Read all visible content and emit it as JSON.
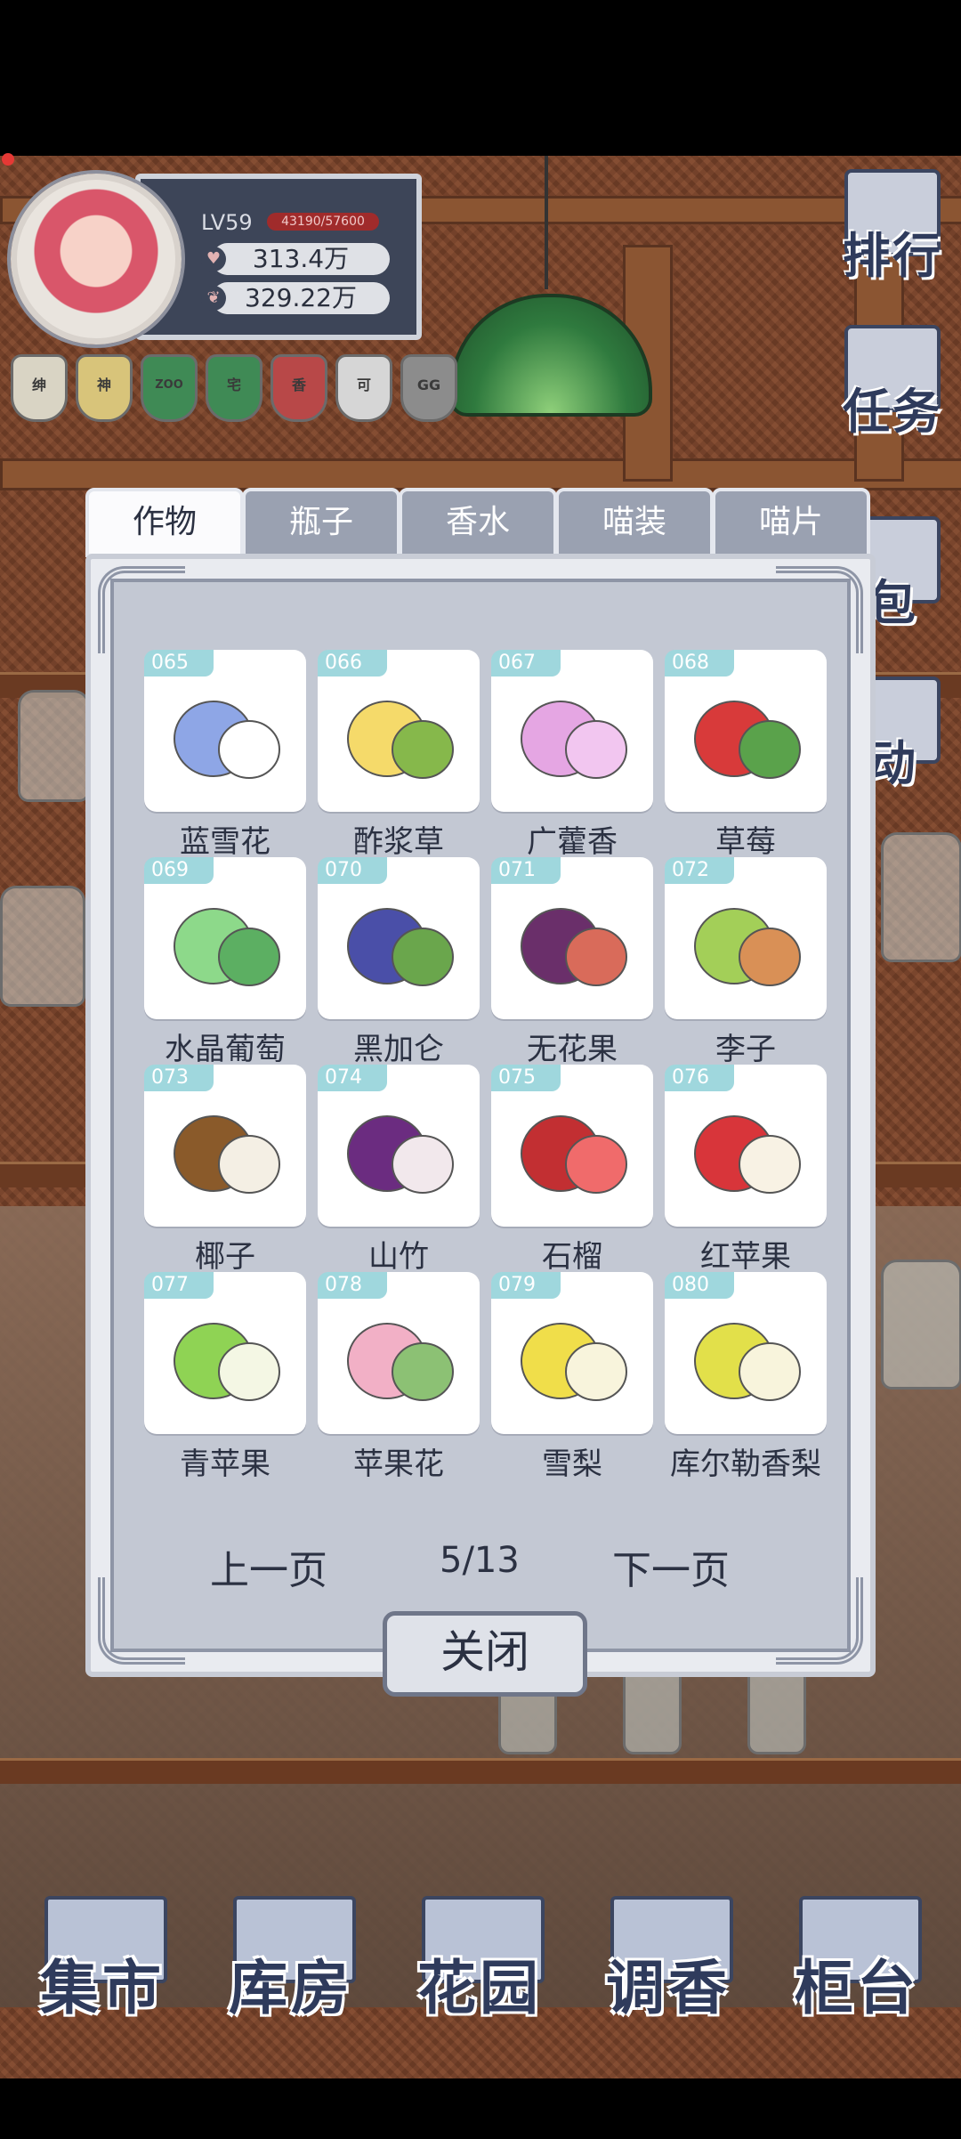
{
  "profile": {
    "level": "LV59",
    "exp": "43190/57600",
    "resource_1": "313.4万",
    "resource_2": "329.22万"
  },
  "badges": [
    {
      "text": "绅",
      "color": "#d9d4c4"
    },
    {
      "text": "神",
      "color": "#d8c47a"
    },
    {
      "text": "ZOO",
      "color": "#3f8a55"
    },
    {
      "text": "宅",
      "color": "#3f8a55"
    },
    {
      "text": "香",
      "color": "#b84848"
    },
    {
      "text": "可",
      "color": "#d6d6d6"
    },
    {
      "text": "GG",
      "color": "#8c8c8c"
    }
  ],
  "side_menu": {
    "rank": "排行",
    "task": "任务",
    "bag": "包",
    "event": "动"
  },
  "tabs": [
    "作物",
    "瓶子",
    "香水",
    "喵装",
    "喵片"
  ],
  "items": [
    {
      "id": "065",
      "name": "蓝雪花",
      "icon": "blue-flower-icon",
      "c1": "#8ea6e6",
      "c2": "#ffffff"
    },
    {
      "id": "066",
      "name": "酢浆草",
      "icon": "yellow-flower-icon",
      "c1": "#f5da6a",
      "c2": "#86b84b"
    },
    {
      "id": "067",
      "name": "广藿香",
      "icon": "pink-flower-icon",
      "c1": "#e5a6e3",
      "c2": "#f2c6f0"
    },
    {
      "id": "068",
      "name": "草莓",
      "icon": "strawberry-icon",
      "c1": "#d83a3a",
      "c2": "#5aa24b"
    },
    {
      "id": "069",
      "name": "水晶葡萄",
      "icon": "grape-icon",
      "c1": "#8dd98a",
      "c2": "#5caf62"
    },
    {
      "id": "070",
      "name": "黑加仑",
      "icon": "blackcurrant-icon",
      "c1": "#4a4fa8",
      "c2": "#6aa64c"
    },
    {
      "id": "071",
      "name": "无花果",
      "icon": "fig-icon",
      "c1": "#6a2f6a",
      "c2": "#d96b5a"
    },
    {
      "id": "072",
      "name": "李子",
      "icon": "plum-icon",
      "c1": "#a3cf58",
      "c2": "#d99056"
    },
    {
      "id": "073",
      "name": "椰子",
      "icon": "coconut-icon",
      "c1": "#8a5a2a",
      "c2": "#f4efe4"
    },
    {
      "id": "074",
      "name": "山竹",
      "icon": "mangosteen-icon",
      "c1": "#6b2c80",
      "c2": "#f2e8ec"
    },
    {
      "id": "075",
      "name": "石榴",
      "icon": "pomegranate-icon",
      "c1": "#c22f32",
      "c2": "#f06b6b"
    },
    {
      "id": "076",
      "name": "红苹果",
      "icon": "red-apple-icon",
      "c1": "#d8353a",
      "c2": "#f8f2e4"
    },
    {
      "id": "077",
      "name": "青苹果",
      "icon": "green-apple-icon",
      "c1": "#8fd354",
      "c2": "#f4f7e4"
    },
    {
      "id": "078",
      "name": "苹果花",
      "icon": "apple-blossom-icon",
      "c1": "#f2b0c6",
      "c2": "#8cc174"
    },
    {
      "id": "079",
      "name": "雪梨",
      "icon": "pear-icon",
      "c1": "#f0de4a",
      "c2": "#f8f4dc"
    },
    {
      "id": "080",
      "name": "库尔勒香梨",
      "icon": "fragrant-pear-icon",
      "c1": "#e2e04a",
      "c2": "#f8f4dc"
    }
  ],
  "pager": {
    "prev": "上一页",
    "page": "5/13",
    "next": "下一页"
  },
  "close_label": "关闭",
  "bottom_nav": [
    "集市",
    "库房",
    "花园",
    "调香",
    "柜台"
  ]
}
